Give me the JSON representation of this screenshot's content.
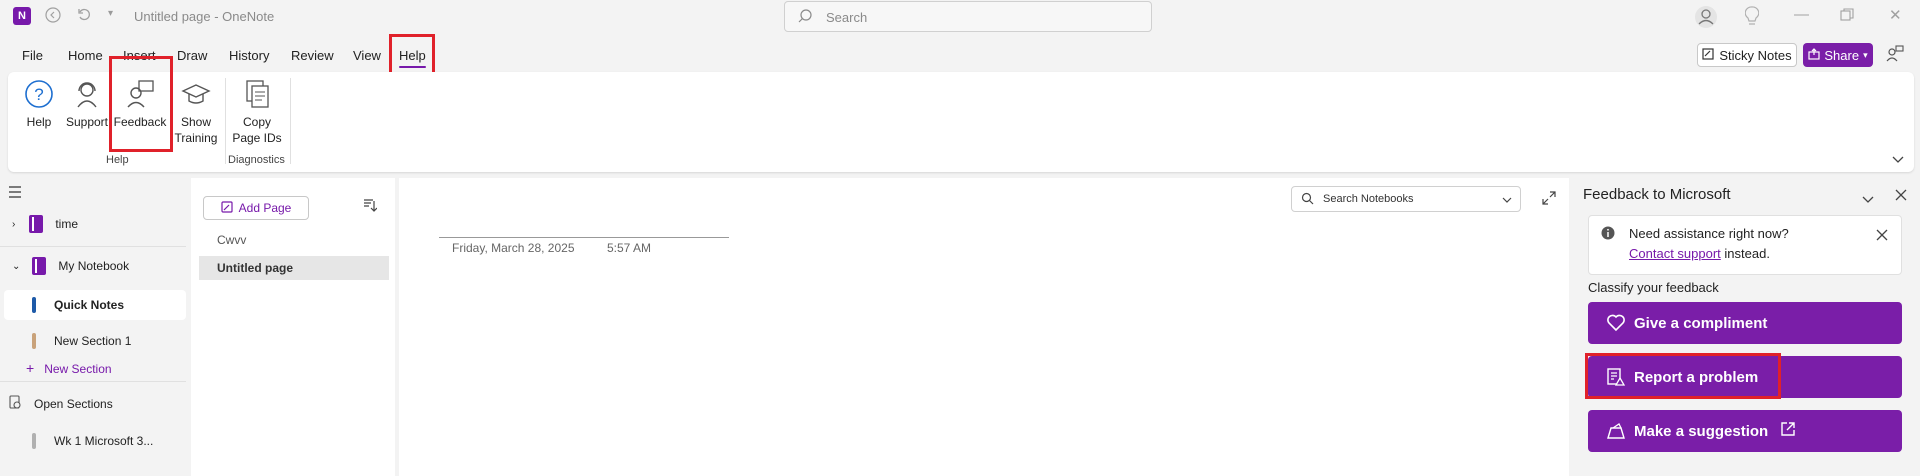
{
  "titlebar": {
    "app_letter": "N",
    "title": "Untitled page  -  OneNote",
    "search_placeholder": "Search"
  },
  "menu": {
    "tabs": [
      "File",
      "Home",
      "Insert",
      "Draw",
      "History",
      "Review",
      "View",
      "Help"
    ],
    "active_tab": "Help"
  },
  "toolbar_right": {
    "sticky_notes": "Sticky Notes",
    "share": "Share"
  },
  "ribbon": {
    "buttons": {
      "help": "Help",
      "support": "Support",
      "feedback": "Feedback",
      "show_training_1": "Show",
      "show_training_2": "Training",
      "copy_ids_1": "Copy",
      "copy_ids_2": "Page IDs"
    },
    "groups": {
      "help": "Help",
      "diagnostics": "Diagnostics"
    }
  },
  "nav": {
    "notebooks": [
      {
        "name": "time"
      },
      {
        "name": "My Notebook"
      }
    ],
    "sections": [
      {
        "name": "Quick Notes",
        "color": "#1e5aa8"
      },
      {
        "name": "New Section 1",
        "color": "#c9a27a"
      }
    ],
    "new_section": "New Section",
    "open_sections": "Open Sections",
    "other": "Wk 1 Microsoft 3..."
  },
  "pagelist": {
    "add_page": "Add Page",
    "pages": [
      "Cwvv",
      "Untitled page"
    ],
    "selected_page": "Untitled page"
  },
  "canvas": {
    "search_notebooks": "Search Notebooks",
    "date": "Friday, March 28, 2025",
    "time": "5:57 AM"
  },
  "feedback": {
    "title": "Feedback to Microsoft",
    "assist_text": "Need assistance right now?",
    "contact_link": "Contact support",
    "contact_suffix": " instead.",
    "classify": "Classify your feedback",
    "compliment": "Give a compliment",
    "problem": "Report a problem",
    "suggestion": "Make a suggestion"
  },
  "colors": {
    "accent": "#7a1ea8",
    "highlight": "#e0212a"
  }
}
